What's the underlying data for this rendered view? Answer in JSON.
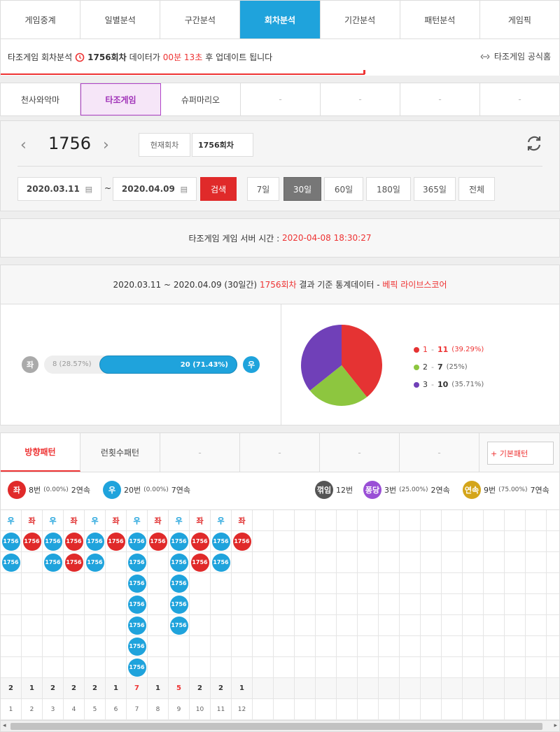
{
  "topnav": [
    "게임중계",
    "일별분석",
    "구간분석",
    "회차분석",
    "기간분석",
    "패턴분석",
    "게임픽"
  ],
  "topnav_active": 3,
  "notice": {
    "prefix": "타조게임 회차분석",
    "round": "1756회차",
    "mid": "데이터가",
    "countdown": "00분 13초",
    "suffix": "후 업데이트 됩니다",
    "homepage": "타조게임 공식홈"
  },
  "gamenav": [
    "천사와악마",
    "타조게임",
    "슈퍼마리오",
    "-",
    "-",
    "-",
    "-"
  ],
  "gamenav_active": 1,
  "control": {
    "round_number": "1756",
    "current_label": "현재회차",
    "current_value": "1756회차",
    "date_from": "2020.03.11",
    "date_sep": "~",
    "date_to": "2020.04.09",
    "search": "검색",
    "periods": [
      "7일",
      "30일",
      "60일",
      "180일",
      "365일",
      "전체"
    ],
    "period_active": 1
  },
  "server": {
    "label": "타조게임 게임 서버 시간 :",
    "time": "2020-04-08 18:30:27"
  },
  "stats": {
    "range": "2020.03.11 ~ 2020.04.09 (30일간)",
    "round": "1756회차",
    "mid": "결과 기준 통계데이터 -",
    "source": "베픽 라이브스코어",
    "left_label": "좌",
    "right_label": "우",
    "left_value": "8 (28.57%)",
    "right_value": "20 (71.43%)",
    "right_fraction": 0.7143
  },
  "chart_data": {
    "type": "pie",
    "categories": [
      "1",
      "2",
      "3"
    ],
    "values": [
      11,
      7,
      10
    ],
    "labels": [
      "11 (39.29%)",
      "7 (25%)",
      "10 (35.71%)"
    ],
    "colors": [
      "#e53333",
      "#8dc63f",
      "#7040b8"
    ],
    "legend": "right"
  },
  "patterns": {
    "tabs": [
      "방향패턴",
      "런횟수패턴",
      "-",
      "-",
      "-",
      "-"
    ],
    "active": 0,
    "basic_btn": "+ 기본패턴",
    "summary": {
      "left": {
        "label": "좌",
        "count": "8번",
        "pct": "(0.00%)",
        "streak": "2연속"
      },
      "right": {
        "label": "우",
        "count": "20번",
        "pct": "(0.00%)",
        "streak": "7연속"
      },
      "break": {
        "label": "꺾임",
        "count": "12번"
      },
      "pingpong": {
        "label": "퐁당",
        "count": "3번",
        "pct": "(25.00%)",
        "streak": "2연속"
      },
      "consecutive": {
        "label": "연속",
        "count": "9번",
        "pct": "(75.00%)",
        "streak": "7연속"
      }
    },
    "ball_label": "1756",
    "columns": [
      {
        "side": "우",
        "balls": 2,
        "count": "2",
        "index": "1"
      },
      {
        "side": "좌",
        "balls": 1,
        "count": "1",
        "index": "2"
      },
      {
        "side": "우",
        "balls": 2,
        "count": "2",
        "index": "3"
      },
      {
        "side": "좌",
        "balls": 2,
        "count": "2",
        "index": "4"
      },
      {
        "side": "우",
        "balls": 2,
        "count": "2",
        "index": "5"
      },
      {
        "side": "좌",
        "balls": 1,
        "count": "1",
        "index": "6"
      },
      {
        "side": "우",
        "balls": 7,
        "count": "7",
        "index": "7"
      },
      {
        "side": "좌",
        "balls": 1,
        "count": "1",
        "index": "8"
      },
      {
        "side": "우",
        "balls": 5,
        "count": "5",
        "index": "9"
      },
      {
        "side": "좌",
        "balls": 2,
        "count": "2",
        "index": "10"
      },
      {
        "side": "우",
        "balls": 2,
        "count": "2",
        "index": "11"
      },
      {
        "side": "좌",
        "balls": 1,
        "count": "1",
        "index": "12"
      }
    ],
    "highlight_counts": [
      "7",
      "5"
    ]
  },
  "colors": {
    "blue": "#1fa3dc",
    "red": "#e02a2a",
    "gray": "#555555",
    "purple": "#9a4fd6",
    "gold": "#d4a51a"
  }
}
